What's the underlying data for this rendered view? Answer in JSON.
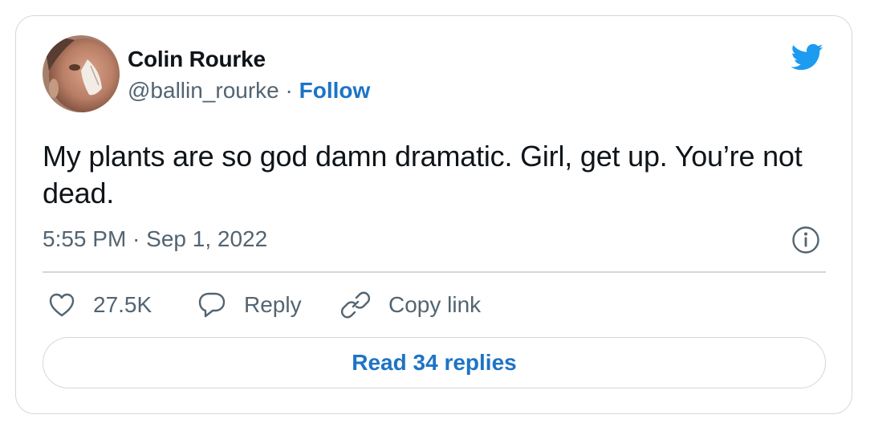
{
  "author": {
    "name": "Colin Rourke",
    "handle": "@ballin_rourke",
    "separator": "·",
    "follow_label": "Follow"
  },
  "tweet": {
    "text": "My plants are so god damn dramatic. Girl, get up. You’re not dead.",
    "timestamp": "5:55 PM · Sep 1, 2022"
  },
  "actions": {
    "likes_count": "27.5K",
    "reply_label": "Reply",
    "copy_link_label": "Copy link"
  },
  "read_replies_label": "Read 34 replies",
  "colors": {
    "accent": "#1d74c6",
    "twitter_blue": "#1d9bf0",
    "secondary_text": "#536471",
    "border": "#cfd9de"
  },
  "icons": [
    "avatar-photo",
    "twitter-bird-icon",
    "info-icon",
    "heart-icon",
    "reply-bubble-icon",
    "link-icon"
  ]
}
